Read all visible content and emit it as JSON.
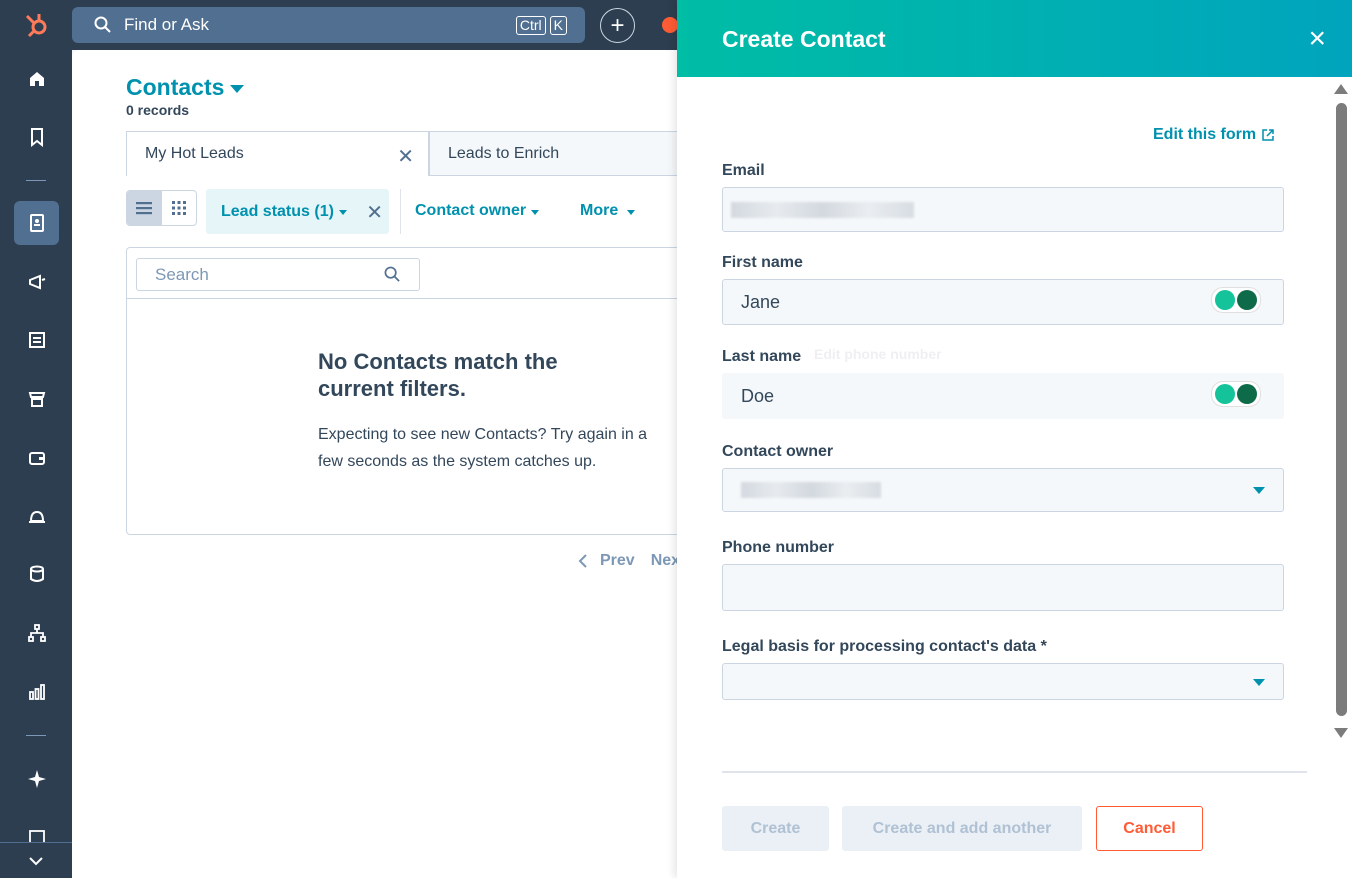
{
  "topbar": {
    "search_text": "Find or Ask",
    "kbd_ctrl": "Ctrl",
    "kbd_k": "K",
    "plus": "+"
  },
  "contacts": {
    "title": "Contacts",
    "records": "0 records",
    "tabs": [
      {
        "label": "My Hot Leads"
      },
      {
        "label": "Leads to Enrich"
      }
    ],
    "filters": {
      "lead_status": "Lead status (1)",
      "contact_owner": "Contact owner",
      "more": "More"
    },
    "search_placeholder": "Search",
    "empty_title": "No Contacts match the current filters.",
    "empty_desc": "Expecting to see new Contacts? Try again in a few seconds as the system catches up.",
    "pager": {
      "prev": "Prev",
      "next": "Nex"
    }
  },
  "panel": {
    "title": "Create Contact",
    "close": "×",
    "edit_form": "Edit this form",
    "fields": {
      "email_label": "Email",
      "first_name_label": "First name",
      "first_name_value": "Jane",
      "last_name_label": "Last name",
      "last_name_value": "Doe",
      "contact_owner_label": "Contact owner",
      "phone_label": "Phone number",
      "legal_label": "Legal basis for processing contact's data *"
    },
    "ghost_title": "Edit phone number",
    "buttons": {
      "create": "Create",
      "create_another": "Create and add another",
      "cancel": "Cancel"
    }
  },
  "colors": {
    "nav": "#2d3e50",
    "accent": "#0091ae",
    "header_gradient_start": "#00bda5",
    "header_gradient_end": "#00a4bd",
    "cancel": "#ff5c35"
  }
}
